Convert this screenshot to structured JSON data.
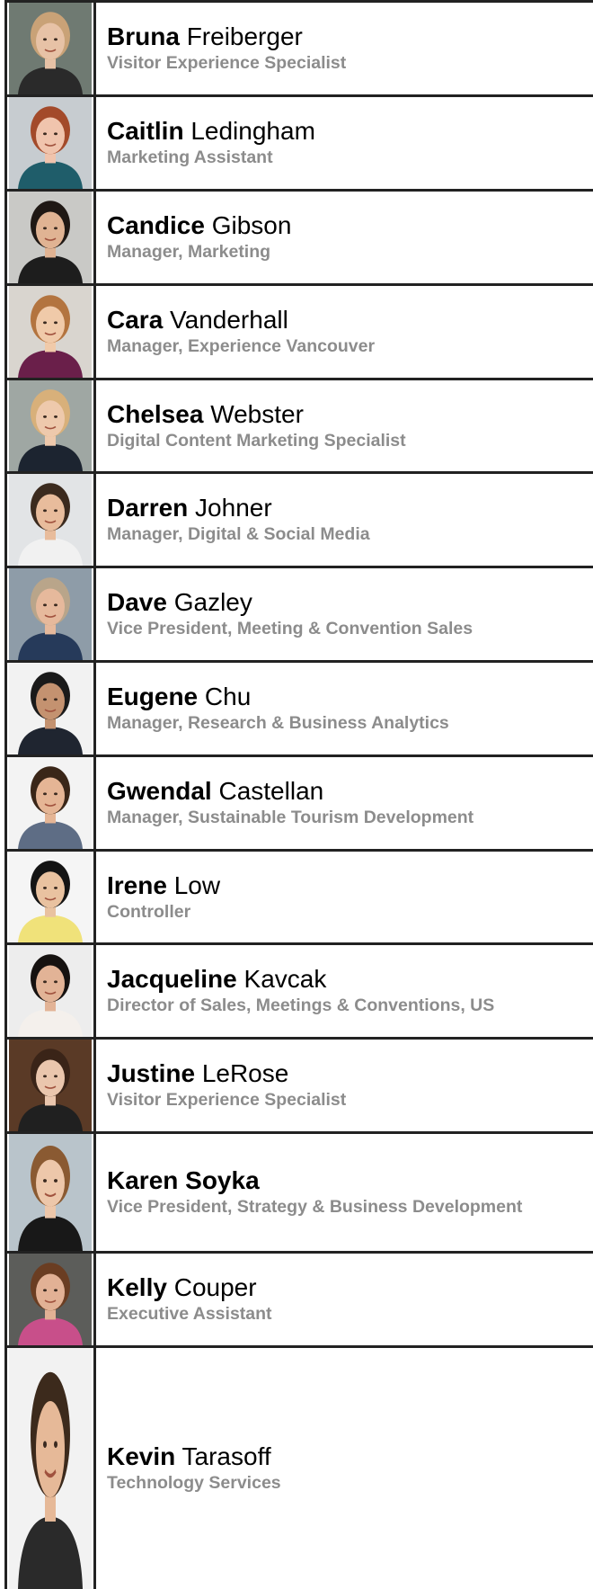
{
  "staff": [
    {
      "first": "Bruna",
      "last": "Freiberger",
      "title": "Visitor Experience Specialist",
      "bg": "#6f7a72",
      "skin": "#e7c2a6",
      "hair": "#c9a277",
      "shirt": "#2a2a2a"
    },
    {
      "first": "Caitlin",
      "last": "Ledingham",
      "title": "Marketing Assistant",
      "bg": "#c7ccd0",
      "skin": "#f0c4ad",
      "hair": "#a34a2a",
      "shirt": "#1f5d6a"
    },
    {
      "first": "Candice",
      "last": "Gibson",
      "title": "Manager, Marketing",
      "bg": "#c9c9c6",
      "skin": "#e0b393",
      "hair": "#1f1814",
      "shirt": "#1d1d1d"
    },
    {
      "first": "Cara",
      "last": "Vanderhall",
      "title": "Manager, Experience Vancouver",
      "bg": "#d9d5cf",
      "skin": "#f0caa9",
      "hair": "#b3743f",
      "shirt": "#6a1f4a"
    },
    {
      "first": "Chelsea",
      "last": "Webster",
      "title": "Digital Content Marketing Specialist",
      "bg": "#9fa7a3",
      "skin": "#eec9ac",
      "hair": "#d8b07a",
      "shirt": "#1c2430"
    },
    {
      "first": "Darren",
      "last": "Johner",
      "title": "Manager, Digital & Social Media",
      "bg": "#e2e4e6",
      "skin": "#e8bc9c",
      "hair": "#3b2a1e",
      "shirt": "#f1f1f1"
    },
    {
      "first": "Dave",
      "last": "Gazley",
      "title": "Vice President, Meeting & Convention Sales",
      "bg": "#8e9ca8",
      "skin": "#e6b99c",
      "hair": "#b9a58a",
      "shirt": "#263a5a"
    },
    {
      "first": "Eugene",
      "last": "Chu",
      "title": "Manager, Research & Business Analytics",
      "bg": "#f2f2f2",
      "skin": "#c49270",
      "hair": "#1a1a1a",
      "shirt": "#1f2530"
    },
    {
      "first": "Gwendal",
      "last": "Castellan",
      "title": "Manager, Sustainable Tourism Development",
      "bg": "#f3f3f3",
      "skin": "#e5b595",
      "hair": "#3a2618",
      "shirt": "#5e6d85"
    },
    {
      "first": "Irene",
      "last": "Low",
      "title": "Controller",
      "bg": "#f5f5f5",
      "skin": "#e9c2a0",
      "hair": "#141414",
      "shirt": "#f0e27a"
    },
    {
      "first": "Jacqueline",
      "last": "Kavcak",
      "title": "Director of Sales, Meetings & Conventions, US",
      "bg": "#ededed",
      "skin": "#e2b396",
      "hair": "#161210",
      "shirt": "#f4f0ec"
    },
    {
      "first": "Justine",
      "last": "LeRose",
      "title": "Visitor Experience Specialist",
      "bg": "#5a3a26",
      "skin": "#eac6ad",
      "hair": "#3a2418",
      "shirt": "#202020"
    },
    {
      "first": "Karen",
      "last": "Soyka",
      "title": "Vice President, Strategy & Business Development",
      "bg": "#b9c4cb",
      "skin": "#edc7aa",
      "hair": "#8a5a32",
      "shirt": "#181818"
    },
    {
      "first": "Kelly",
      "last": "Couper",
      "title": "Executive Assistant",
      "bg": "#5c5d5a",
      "skin": "#e2b195",
      "hair": "#6a3d22",
      "shirt": "#c84f8a"
    },
    {
      "first": "Kevin",
      "last": "Tarasoff",
      "title": "Technology Services",
      "bg": "#f2f2f2",
      "skin": "#e6b998",
      "hair": "#3c2a1c",
      "shirt": "#2a2a2a"
    }
  ]
}
